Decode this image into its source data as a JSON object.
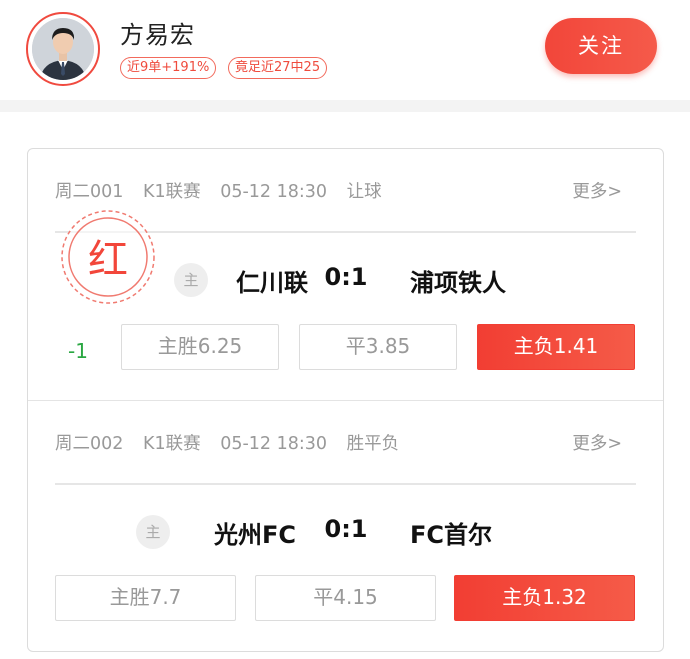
{
  "expert": {
    "name": "方易宏",
    "badges": [
      "近9单+191%",
      "竟足近27中25"
    ],
    "follow_label": "关注"
  },
  "colors": {
    "accent": "#f2463a",
    "handicap_green": "#2aa742",
    "muted": "#999999"
  },
  "matches": [
    {
      "code": "周二001",
      "league": "K1联赛",
      "time": "05-12 18:30",
      "play_type": "让球",
      "more_label": "更多>",
      "home_tag": "主",
      "home_team": "仁川联",
      "score": "0:1",
      "away_team": "浦项铁人",
      "result_stamp": "红",
      "handicap": "-1",
      "odds": [
        {
          "label": "主胜6.25",
          "selected": false
        },
        {
          "label": "平3.85",
          "selected": false
        },
        {
          "label": "主负1.41",
          "selected": true
        }
      ]
    },
    {
      "code": "周二002",
      "league": "K1联赛",
      "time": "05-12 18:30",
      "play_type": "胜平负",
      "more_label": "更多>",
      "home_tag": "主",
      "home_team": "光州FC",
      "score": "0:1",
      "away_team": "FC首尔",
      "odds": [
        {
          "label": "主胜7.7",
          "selected": false
        },
        {
          "label": "平4.15",
          "selected": false
        },
        {
          "label": "主负1.32",
          "selected": true
        }
      ]
    }
  ]
}
